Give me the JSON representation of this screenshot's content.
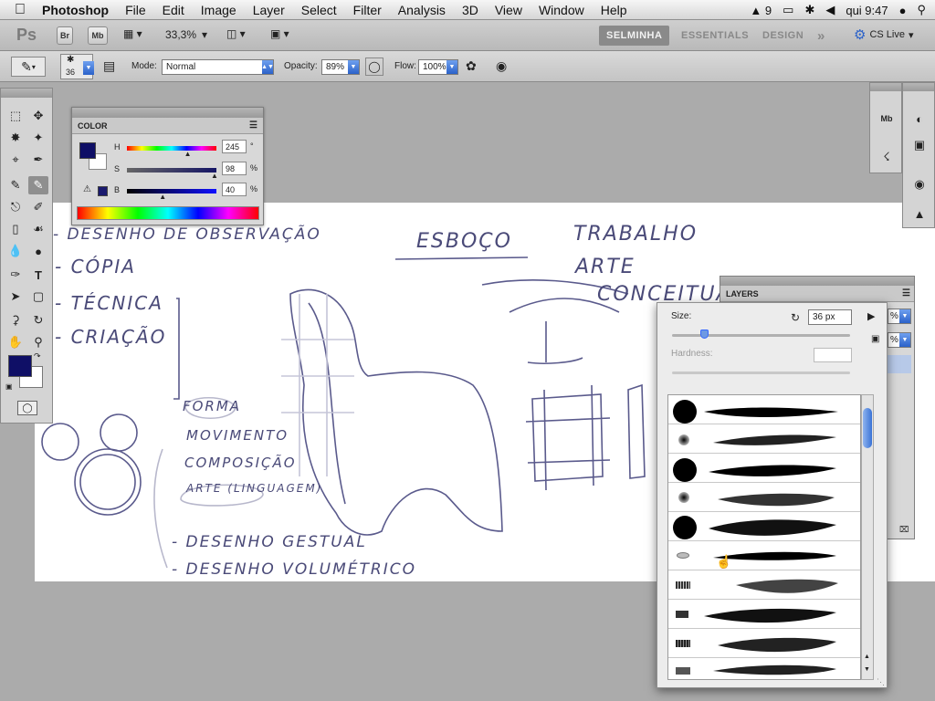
{
  "menubar": {
    "app_name": "Photoshop",
    "items": [
      "File",
      "Edit",
      "Image",
      "Layer",
      "Select",
      "Filter",
      "Analysis",
      "3D",
      "View",
      "Window",
      "Help"
    ],
    "status_badge": "9",
    "clock": "qui 9:47"
  },
  "appbar": {
    "logo": "Ps",
    "bridge_label": "Br",
    "minibridge_label": "Mb",
    "zoom": "33,3%",
    "workspaces": [
      "SELMINHA",
      "ESSENTIALS",
      "DESIGN"
    ],
    "more": "»",
    "cs_live": "CS Live"
  },
  "options": {
    "brush_size": "36",
    "mode_label": "Mode:",
    "mode_value": "Normal",
    "opacity_label": "Opacity:",
    "opacity_value": "89%",
    "flow_label": "Flow:",
    "flow_value": "100%"
  },
  "color_panel": {
    "title": "COLOR",
    "h_label": "H",
    "h_value": "245",
    "h_unit": "°",
    "s_label": "S",
    "s_value": "98",
    "s_unit": "%",
    "b_label": "B",
    "b_value": "40",
    "b_unit": "%",
    "h_pos": 0.68,
    "s_pos": 0.98,
    "b_pos": 0.4,
    "foreground": "#0f0f66",
    "background": "#ffffff"
  },
  "layers_panel": {
    "title": "LAYERS",
    "opacity_fragment": "%",
    "fill_fragment": "%"
  },
  "brush_picker": {
    "size_label": "Size:",
    "size_value": "36 px",
    "size_pos": 0.18,
    "hardness_label": "Hardness:"
  },
  "canvas_notes": {
    "list1": [
      "- DESENHO DE OBSERVAÇÃO",
      "- CÓPIA",
      "- TÉCNICA",
      "- CRIAÇÃO"
    ],
    "center_title": "ESBOÇO",
    "right_list": [
      "TRABALHO",
      "ARTE",
      "CONCEITUAL"
    ],
    "mid_list": [
      "FORMA",
      "MOVIMENTO",
      "COMPOSIÇÃO",
      "ARTE (LINGUAGEM)"
    ],
    "bottom_list": [
      "- DESENHO GESTUAL",
      "- DESENHO VOLUMÉTRICO"
    ]
  },
  "colors": {
    "accent": "#2b62c9",
    "ink": "#4a4a78"
  }
}
